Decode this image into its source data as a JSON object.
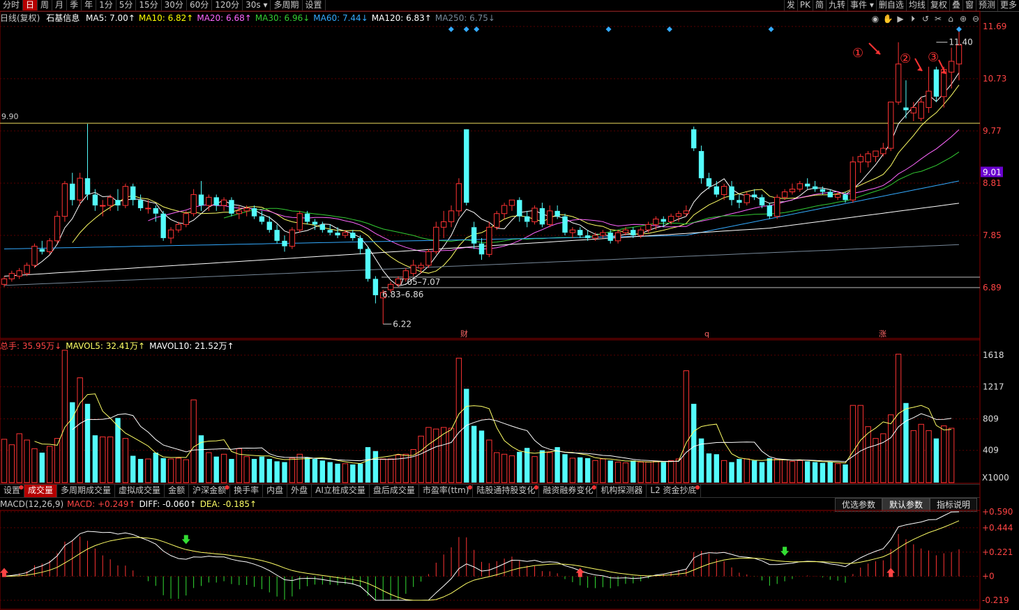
{
  "toolbar": {
    "tabs": [
      "分时",
      "日",
      "周",
      "月",
      "季",
      "年",
      "1分",
      "5分",
      "15分",
      "30分",
      "60分",
      "120分",
      "30s ▾",
      "多周期",
      "设置"
    ],
    "active_tab": 1,
    "right_tabs": [
      "发",
      "PK",
      "简",
      "九转",
      "事件 ▾",
      "删自选",
      "均线",
      "复权",
      "叠",
      "窗",
      "预测",
      "更多"
    ]
  },
  "stock": {
    "name": "石基信息",
    "period": "日线(复权)"
  },
  "ma_legend": [
    {
      "label": "MA5: 7.00↑",
      "color": "#ffffff"
    },
    {
      "label": "MA10: 6.82↑",
      "color": "#ffff00"
    },
    {
      "label": "MA20: 6.68↑",
      "color": "#ff66ff"
    },
    {
      "label": "MA30: 6.96↓",
      "color": "#33cc33"
    },
    {
      "label": "MA60: 7.44↓",
      "color": "#33aaff"
    },
    {
      "label": "MA120: 6.83↑",
      "color": "#ffffff"
    },
    {
      "label": "MA250: 6.75↓",
      "color": "#778899"
    }
  ],
  "price_axis": {
    "ticks": [
      "11.69",
      "10.73",
      "9.77",
      "8.81",
      "7.85",
      "6.89"
    ],
    "current": "9.01",
    "left_level": "9.90"
  },
  "annotations": {
    "high": "11.40",
    "low": "6.22",
    "range1": "7.05–7.07",
    "range2": "6.83–6.86",
    "circle1": "①",
    "circle2": "②",
    "circle3": "③",
    "event_cai": "财",
    "event_q": "q",
    "event_zhang": "涨"
  },
  "volume": {
    "legend": [
      {
        "label": "总手: 35.95万↓",
        "color": "#ff4444"
      },
      {
        "label": "MAVOL5: 32.41万↑",
        "color": "#ffff66"
      },
      {
        "label": "MAVOL10: 21.52万↑",
        "color": "#ffffff"
      }
    ],
    "axis": [
      "1618",
      "1217",
      "809",
      "409"
    ],
    "unit": "X1000"
  },
  "indicator_tabs": [
    {
      "label": "设置",
      "dot": true
    },
    {
      "label": "成交量",
      "dot": false
    },
    {
      "label": "多周期成交量",
      "dot": false
    },
    {
      "label": "虚拟成交量",
      "dot": false
    },
    {
      "label": "金额",
      "dot": false
    },
    {
      "label": "沪深金额",
      "dot": true
    },
    {
      "label": "换手率",
      "dot": false
    },
    {
      "label": "内盘",
      "dot": false
    },
    {
      "label": "外盘",
      "dot": false
    },
    {
      "label": "AI立桩成交量",
      "dot": false
    },
    {
      "label": "盘后成交量",
      "dot": false
    },
    {
      "label": "市盈率(ttm)",
      "dot": true
    },
    {
      "label": "陆股通持股变化",
      "dot": true
    },
    {
      "label": "融资融券变化",
      "dot": true
    },
    {
      "label": "机构探测器",
      "dot": false
    },
    {
      "label": "L2 资金抄底",
      "dot": true
    }
  ],
  "indicator_active": 1,
  "macd": {
    "legend": [
      {
        "label": "MACD(12,26,9)",
        "color": "#c8c8c8"
      },
      {
        "label": "MACD: +0.249↑",
        "color": "#ff4444"
      },
      {
        "label": "DIFF: -0.060↑",
        "color": "#ffffff"
      },
      {
        "label": "DEA: -0.185↑",
        "color": "#ffff66"
      }
    ],
    "axis": [
      "+0.590",
      "+0.444",
      "+0.221",
      "+0",
      "-0.219"
    ],
    "buttons": [
      "优选参数",
      "默认参数",
      "指标说明"
    ],
    "active_button": 1
  },
  "chart_data": {
    "type": "candlestick",
    "ohlc": [
      [
        6.95,
        7.1,
        6.9,
        7.05
      ],
      [
        7.05,
        7.2,
        7.0,
        7.15
      ],
      [
        7.1,
        7.25,
        7.05,
        7.2
      ],
      [
        7.15,
        7.35,
        7.1,
        7.3
      ],
      [
        7.3,
        7.7,
        7.25,
        7.65
      ],
      [
        7.6,
        7.75,
        7.5,
        7.55
      ],
      [
        7.55,
        7.8,
        7.5,
        7.75
      ],
      [
        7.75,
        8.3,
        7.7,
        8.2
      ],
      [
        8.2,
        8.85,
        8.1,
        8.8
      ],
      [
        8.8,
        9.0,
        8.4,
        8.5
      ],
      [
        8.5,
        9.0,
        8.4,
        8.9
      ],
      [
        8.9,
        9.9,
        8.5,
        8.6
      ],
      [
        8.6,
        8.7,
        8.3,
        8.4
      ],
      [
        8.4,
        8.5,
        8.2,
        8.4
      ],
      [
        8.4,
        8.6,
        8.3,
        8.55
      ],
      [
        8.5,
        8.7,
        8.3,
        8.4
      ],
      [
        8.4,
        8.8,
        8.35,
        8.75
      ],
      [
        8.75,
        8.8,
        8.4,
        8.5
      ],
      [
        8.5,
        8.6,
        8.3,
        8.35
      ],
      [
        8.35,
        8.5,
        8.25,
        8.35
      ],
      [
        8.35,
        8.4,
        8.1,
        8.25
      ],
      [
        8.25,
        8.3,
        7.75,
        7.8
      ],
      [
        7.8,
        8.0,
        7.7,
        7.95
      ],
      [
        7.95,
        8.1,
        7.9,
        8.05
      ],
      [
        8.05,
        8.3,
        8.0,
        8.25
      ],
      [
        8.25,
        8.7,
        8.2,
        8.6
      ],
      [
        8.6,
        8.85,
        8.3,
        8.4
      ],
      [
        8.4,
        8.6,
        8.3,
        8.55
      ],
      [
        8.55,
        8.6,
        8.3,
        8.4
      ],
      [
        8.4,
        8.55,
        8.3,
        8.5
      ],
      [
        8.5,
        8.55,
        8.2,
        8.25
      ],
      [
        8.25,
        8.4,
        8.15,
        8.3
      ],
      [
        8.3,
        8.4,
        8.2,
        8.35
      ],
      [
        8.35,
        8.4,
        8.15,
        8.2
      ],
      [
        8.2,
        8.3,
        8.05,
        8.1
      ],
      [
        8.1,
        8.2,
        7.9,
        7.95
      ],
      [
        7.95,
        8.05,
        7.7,
        7.75
      ],
      [
        7.75,
        7.85,
        7.55,
        7.65
      ],
      [
        7.65,
        8.0,
        7.6,
        7.95
      ],
      [
        7.95,
        8.3,
        7.9,
        8.25
      ],
      [
        8.25,
        8.3,
        8.05,
        8.1
      ],
      [
        8.1,
        8.15,
        7.95,
        8.05
      ],
      [
        8.05,
        8.1,
        7.9,
        7.95
      ],
      [
        7.95,
        8.05,
        7.85,
        7.9
      ],
      [
        7.9,
        8.0,
        7.8,
        7.85
      ],
      [
        7.85,
        7.95,
        7.8,
        7.9
      ],
      [
        7.9,
        7.95,
        7.75,
        7.8
      ],
      [
        7.8,
        7.85,
        7.5,
        7.6
      ],
      [
        7.6,
        7.65,
        7.0,
        7.05
      ],
      [
        7.05,
        7.1,
        6.6,
        6.75
      ],
      [
        6.7,
        6.85,
        6.22,
        6.8
      ],
      [
        6.85,
        7.0,
        6.8,
        6.95
      ],
      [
        6.95,
        7.1,
        6.9,
        7.05
      ],
      [
        7.05,
        7.25,
        7.0,
        7.2
      ],
      [
        7.15,
        7.4,
        7.1,
        7.3
      ],
      [
        7.25,
        7.35,
        7.15,
        7.3
      ],
      [
        7.3,
        7.6,
        7.25,
        7.55
      ],
      [
        7.55,
        8.1,
        7.5,
        8.0
      ],
      [
        8.0,
        8.3,
        7.8,
        8.1
      ],
      [
        8.1,
        8.4,
        8.0,
        8.3
      ],
      [
        8.3,
        8.9,
        8.2,
        8.8
      ],
      [
        9.8,
        9.8,
        8.4,
        8.45
      ],
      [
        8.0,
        8.1,
        7.6,
        7.7
      ],
      [
        7.7,
        7.8,
        7.4,
        7.5
      ],
      [
        7.5,
        8.1,
        7.45,
        8.0
      ],
      [
        8.0,
        8.3,
        7.95,
        8.25
      ],
      [
        8.25,
        8.45,
        8.15,
        8.4
      ],
      [
        8.4,
        8.5,
        8.3,
        8.5
      ],
      [
        8.5,
        8.55,
        8.1,
        8.2
      ],
      [
        8.2,
        8.3,
        8.0,
        8.1
      ],
      [
        8.1,
        8.4,
        8.05,
        8.35
      ],
      [
        8.35,
        8.45,
        8.0,
        8.05
      ],
      [
        8.05,
        8.4,
        8.0,
        8.3
      ],
      [
        8.3,
        8.4,
        8.15,
        8.2
      ],
      [
        8.2,
        8.25,
        7.85,
        7.9
      ],
      [
        7.9,
        8.0,
        7.8,
        7.95
      ],
      [
        7.95,
        8.0,
        7.8,
        7.85
      ],
      [
        7.85,
        7.95,
        7.75,
        7.8
      ],
      [
        7.8,
        7.9,
        7.75,
        7.85
      ],
      [
        7.85,
        7.95,
        7.8,
        7.9
      ],
      [
        7.9,
        7.95,
        7.7,
        7.75
      ],
      [
        7.75,
        7.95,
        7.7,
        7.9
      ],
      [
        7.9,
        8.0,
        7.85,
        7.95
      ],
      [
        7.95,
        8.0,
        7.8,
        7.85
      ],
      [
        7.85,
        8.0,
        7.8,
        7.95
      ],
      [
        7.95,
        8.1,
        7.9,
        8.05
      ],
      [
        8.05,
        8.2,
        7.95,
        8.15
      ],
      [
        8.15,
        8.2,
        8.0,
        8.1
      ],
      [
        8.1,
        8.25,
        8.05,
        8.2
      ],
      [
        8.2,
        8.3,
        8.1,
        8.25
      ],
      [
        8.25,
        8.4,
        8.2,
        8.3
      ],
      [
        9.8,
        9.85,
        9.4,
        9.45
      ],
      [
        9.4,
        9.5,
        8.8,
        8.9
      ],
      [
        8.9,
        9.0,
        8.7,
        8.75
      ],
      [
        8.75,
        8.85,
        8.55,
        8.6
      ],
      [
        8.6,
        8.8,
        8.5,
        8.75
      ],
      [
        8.75,
        8.85,
        8.4,
        8.5
      ],
      [
        8.5,
        8.6,
        8.35,
        8.45
      ],
      [
        8.45,
        8.65,
        8.4,
        8.6
      ],
      [
        8.6,
        8.7,
        8.5,
        8.55
      ],
      [
        8.55,
        8.6,
        8.35,
        8.4
      ],
      [
        8.4,
        8.45,
        8.15,
        8.2
      ],
      [
        8.2,
        8.6,
        8.15,
        8.55
      ],
      [
        8.55,
        8.7,
        8.5,
        8.65
      ],
      [
        8.65,
        8.8,
        8.6,
        8.7
      ],
      [
        8.7,
        8.85,
        8.65,
        8.8
      ],
      [
        8.8,
        8.9,
        8.7,
        8.75
      ],
      [
        8.75,
        8.85,
        8.65,
        8.7
      ],
      [
        8.7,
        8.75,
        8.6,
        8.65
      ],
      [
        8.65,
        8.7,
        8.55,
        8.55
      ],
      [
        8.55,
        8.65,
        8.5,
        8.6
      ],
      [
        8.6,
        8.65,
        8.45,
        8.5
      ],
      [
        8.5,
        9.3,
        8.45,
        9.2
      ],
      [
        9.2,
        9.35,
        9.0,
        9.3
      ],
      [
        9.2,
        9.4,
        9.1,
        9.35
      ],
      [
        9.3,
        9.4,
        9.2,
        9.4
      ],
      [
        9.35,
        9.55,
        9.3,
        9.45
      ],
      [
        9.45,
        10.3,
        9.4,
        10.3
      ],
      [
        10.3,
        11.4,
        10.25,
        11.0
      ],
      [
        10.2,
        10.7,
        10.0,
        10.15
      ],
      [
        10.1,
        10.3,
        9.95,
        10.2
      ],
      [
        10.0,
        10.4,
        9.95,
        10.3
      ],
      [
        10.2,
        10.95,
        10.1,
        10.5
      ],
      [
        10.9,
        10.95,
        10.3,
        10.4
      ],
      [
        10.4,
        10.95,
        10.2,
        10.9
      ],
      [
        10.85,
        11.3,
        10.55,
        11.05
      ],
      [
        11.0,
        11.6,
        10.7,
        11.35
      ]
    ],
    "volume_k": [
      550,
      480,
      620,
      540,
      430,
      380,
      460,
      560,
      1680,
      1020,
      1330,
      1000,
      600,
      580,
      580,
      820,
      560,
      340,
      300,
      300,
      380,
      310,
      300,
      310,
      290,
      1050,
      600,
      380,
      330,
      360,
      300,
      430,
      330,
      300,
      330,
      300,
      270,
      260,
      310,
      360,
      320,
      300,
      280,
      260,
      240,
      240,
      230,
      240,
      450,
      400,
      300,
      300,
      350,
      360,
      420,
      590,
      700,
      680,
      700,
      690,
      1580,
      1190,
      720,
      660,
      540,
      380,
      360,
      340,
      390,
      440,
      330,
      410,
      380,
      450,
      360,
      310,
      320,
      310,
      280,
      300,
      280,
      260,
      250,
      280,
      260,
      260,
      270,
      260,
      280,
      300,
      1420,
      1000,
      560,
      370,
      360,
      280,
      260,
      300,
      300,
      280,
      260,
      310,
      300,
      290,
      270,
      280,
      270,
      260,
      250,
      260,
      240,
      230,
      980,
      980,
      710,
      560,
      620,
      860,
      1630,
      1010,
      660,
      740,
      660,
      560,
      720,
      690
    ],
    "markers": {
      "macd_up": [
        0,
        76,
        117,
        158
      ],
      "macd_down": [
        24,
        103,
        143
      ],
      "ma5": [],
      "diamonds": [
        88,
        91,
        93,
        119,
        131,
        151,
        188
      ]
    }
  }
}
